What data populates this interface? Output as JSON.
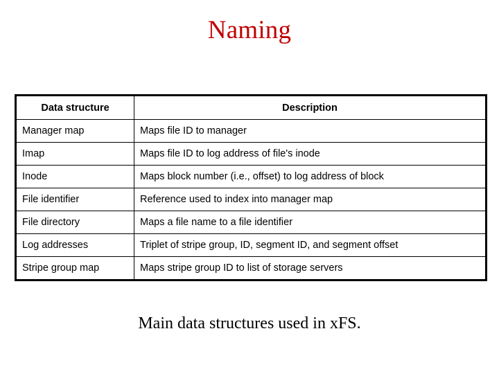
{
  "slide": {
    "title": "Naming",
    "title_color": "#C00000",
    "caption": "Main data structures used in xFS."
  },
  "table": {
    "headers": [
      "Data structure",
      "Description"
    ],
    "rows": [
      {
        "name": "Manager map",
        "description": "Maps file ID to manager"
      },
      {
        "name": "Imap",
        "description": "Maps file ID to log address of file's inode"
      },
      {
        "name": "Inode",
        "description": "Maps block number (i.e., offset) to log address of block"
      },
      {
        "name": "File identifier",
        "description": "Reference used to index into manager map"
      },
      {
        "name": "File directory",
        "description": "Maps a file name to a file identifier"
      },
      {
        "name": "Log addresses",
        "description": "Triplet of stripe group, ID, segment ID, and segment offset"
      },
      {
        "name": "Stripe group map",
        "description": "Maps stripe group ID to list of storage servers"
      }
    ]
  }
}
